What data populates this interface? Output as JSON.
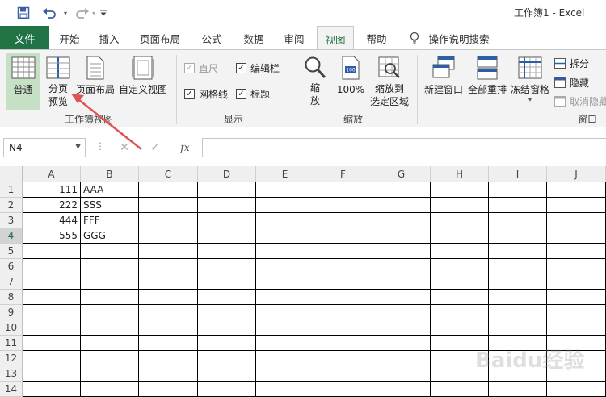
{
  "window": {
    "title": "工作簿1  -  Excel"
  },
  "quick_access": {
    "save": "save-icon",
    "undo": "undo-icon",
    "redo": "redo-icon",
    "customize": "customize-qat-icon"
  },
  "tabs": {
    "file": "文件",
    "home": "开始",
    "insert": "插入",
    "page_layout": "页面布局",
    "formulas": "公式",
    "data": "数据",
    "review": "审阅",
    "view": "视图",
    "help": "帮助",
    "tell_me": "操作说明搜索"
  },
  "active_tab": "视图",
  "ribbon": {
    "workbook_views": {
      "normal": "普通",
      "page_break_1": "分页",
      "page_break_2": "预览",
      "page_layout": "页面布局",
      "custom_views": "自定义视图",
      "group": "工作簿视图"
    },
    "show": {
      "ruler": "直尺",
      "formula_bar": "编辑栏",
      "gridlines": "网格线",
      "headings": "标题",
      "group": "显示"
    },
    "zoom": {
      "zoom_1": "缩",
      "zoom_2": "放",
      "zoom_100": "100%",
      "zoom_sel_1": "缩放到",
      "zoom_sel_2": "选定区域",
      "group": "缩放"
    },
    "window": {
      "new_window": "新建窗口",
      "arrange_all": "全部重排",
      "freeze_panes": "冻结窗格",
      "split": "拆分",
      "hide": "隐藏",
      "unhide": "取消隐藏",
      "group": "窗口"
    }
  },
  "formula_bar": {
    "name_box": "N4",
    "fx": "fx",
    "cancel": "✕",
    "enter": "✓",
    "formula": ""
  },
  "grid": {
    "columns": [
      "A",
      "B",
      "C",
      "D",
      "E",
      "F",
      "G",
      "H",
      "I",
      "J"
    ],
    "rows": [
      "1",
      "2",
      "3",
      "4",
      "5",
      "6",
      "7",
      "8",
      "9",
      "10",
      "11",
      "12",
      "13",
      "14"
    ],
    "cells": [
      [
        "111",
        "AAA"
      ],
      [
        "222",
        "SSS"
      ],
      [
        "444",
        "FFF"
      ],
      [
        "555",
        "GGG"
      ]
    ]
  },
  "watermark": "Baidu经验",
  "colors": {
    "excel_green": "#217346",
    "annotation_red": "#e05353"
  }
}
